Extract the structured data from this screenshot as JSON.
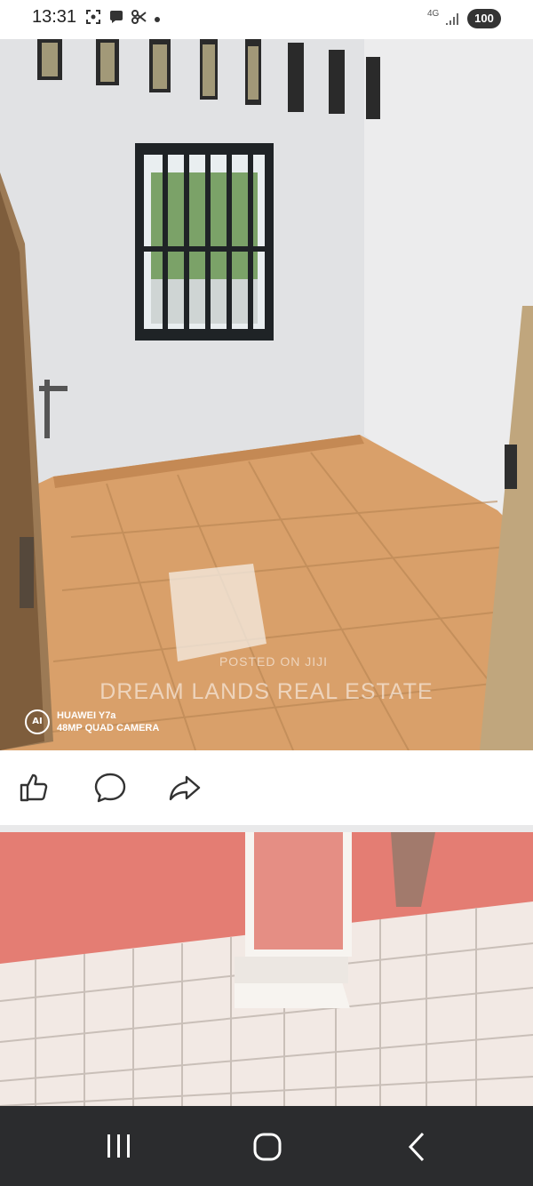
{
  "status_bar": {
    "time": "13:31",
    "network": "4G",
    "battery": "100",
    "icons": [
      "screenshot-icon",
      "chat-bubble-icon",
      "scissors-icon",
      "notification-dot"
    ]
  },
  "post": {
    "photo1": {
      "watermark_small": "POSTED ON JIJI",
      "watermark_large": "DREAM LANDS REAL ESTATE",
      "camera_line1": "HUAWEI Y7a",
      "camera_line2": "48MP QUAD CAMERA",
      "camera_logo": "AI"
    },
    "actions": [
      {
        "name": "like",
        "icon": "thumbs-up-icon"
      },
      {
        "name": "comment",
        "icon": "comment-bubble-icon"
      },
      {
        "name": "share",
        "icon": "share-arrow-icon"
      }
    ]
  },
  "nav": {
    "recents_icon": "recents-icon",
    "home_icon": "home-icon",
    "back_icon": "back-chevron-icon"
  },
  "colors": {
    "nav_bar": "#2b2c2e",
    "wall": "#e6e7e8",
    "floor": "#d9a06a",
    "pink_wall": "#e47d73",
    "tile": "#f2e9e4"
  }
}
